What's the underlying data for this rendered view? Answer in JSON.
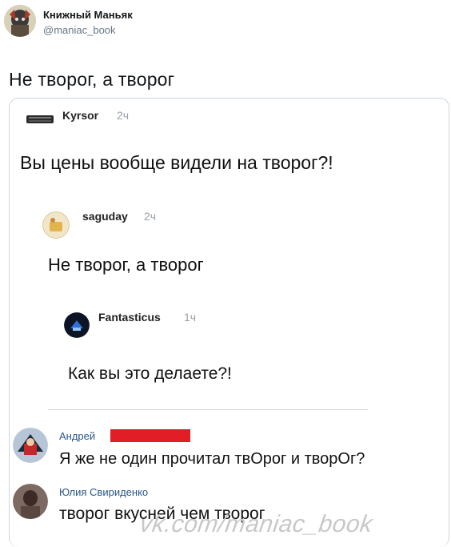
{
  "tweet": {
    "author": {
      "name": "Книжный Маньяк",
      "handle": "@maniac_book"
    },
    "text": "Не творог, а творог"
  },
  "thread": [
    {
      "name": "Kyrsor",
      "time": "2ч",
      "text": "Вы цены вообще видели на творог?!"
    },
    {
      "name": "saguday",
      "time": "2ч",
      "text": "Не творог, а творог"
    },
    {
      "name": "Fantasticus",
      "time": "1ч",
      "text": "Как вы это делаете?!"
    }
  ],
  "vk_comments": [
    {
      "name": "Андрей",
      "text": "Я же не один прочитал твОрог и творОг?"
    },
    {
      "name": "Юлия Свириденко",
      "text": "творог вкусней чем творог"
    }
  ],
  "watermark": "vk.com/maniac_book",
  "colors": {
    "redaction": "#e11d25",
    "vk_link": "#2a5885"
  }
}
